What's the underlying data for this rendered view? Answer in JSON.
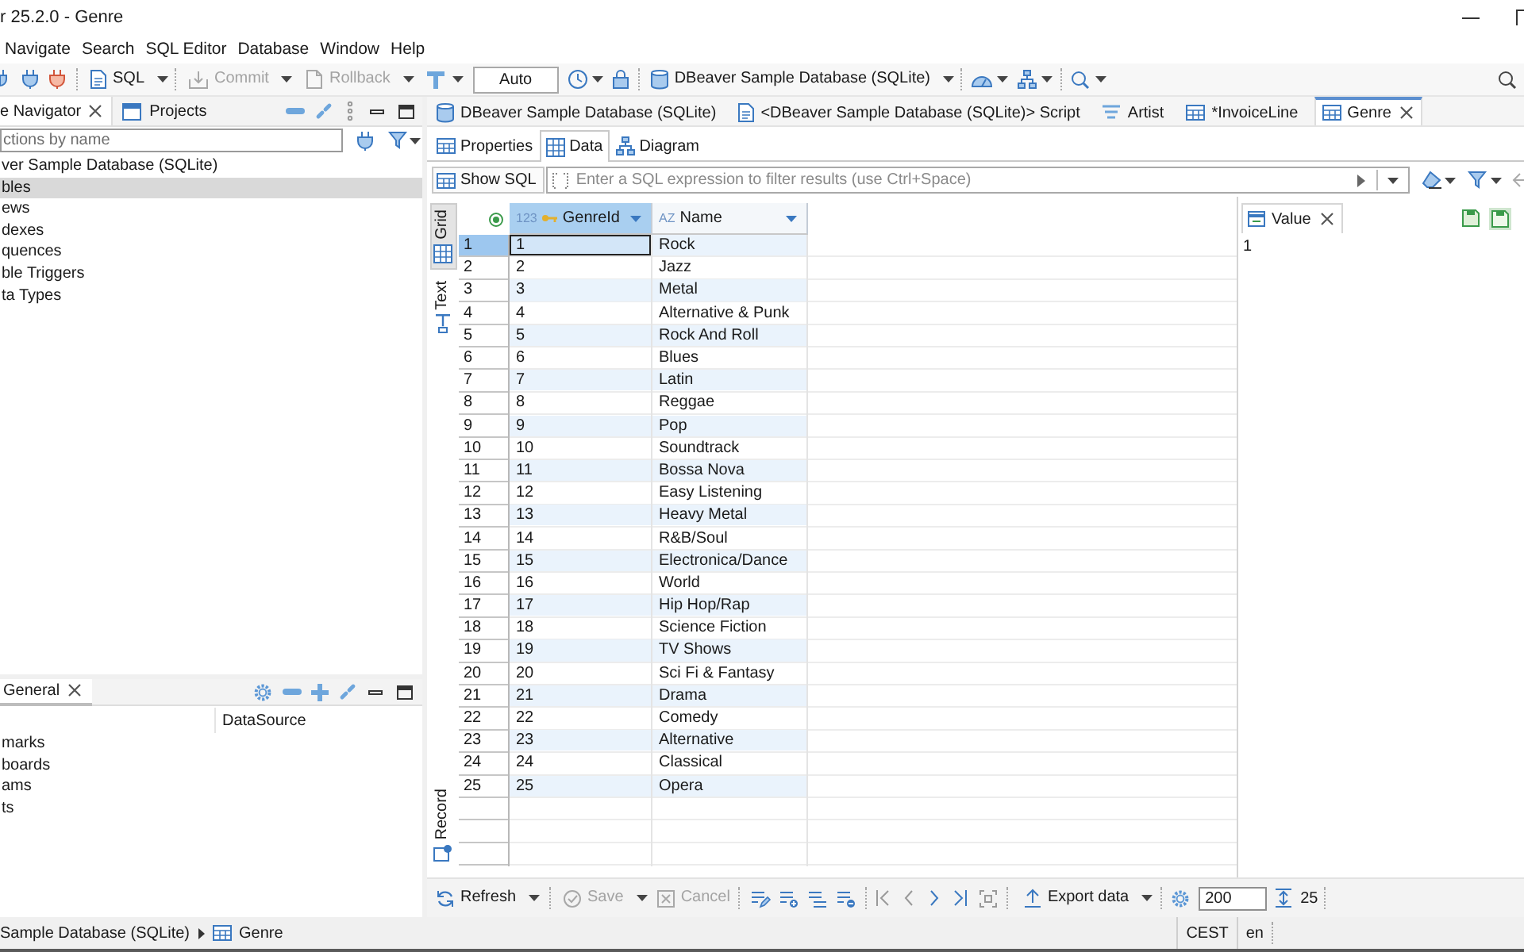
{
  "window": {
    "title": "r 25.2.0 - Genre"
  },
  "menu_bar": {
    "items": [
      "Navigate",
      "Search",
      "SQL Editor",
      "Database",
      "Window",
      "Help"
    ]
  },
  "toolbar": {
    "buttons": [
      {
        "label": "SQL",
        "disabled": false
      },
      {
        "label": "Commit",
        "disabled": true
      },
      {
        "label": "Rollback",
        "disabled": true
      }
    ],
    "transaction_mode": "Auto",
    "active_connection": "DBeaver Sample Database (SQLite)"
  },
  "navigator": {
    "tabs": [
      {
        "label": "e Navigator",
        "selected": true
      },
      {
        "label": "Projects",
        "selected": false
      }
    ],
    "filter": {
      "placeholder": "ctions by name"
    },
    "tree": [
      {
        "label": "ver Sample Database (SQLite)",
        "selected": false,
        "children": [
          {
            "label": "bles",
            "selected": true
          },
          {
            "label": "ews",
            "selected": false
          },
          {
            "label": "dexes",
            "selected": false
          },
          {
            "label": "quences",
            "selected": false
          },
          {
            "label": "ble Triggers",
            "selected": false
          },
          {
            "label": "ta Types",
            "selected": false
          }
        ]
      }
    ]
  },
  "general_panel": {
    "tabs": [
      {
        "label": "General",
        "selected": true
      }
    ],
    "column_2": "DataSource",
    "items": [
      "marks",
      "boards",
      "ams",
      "ts"
    ]
  },
  "editor_tabs": [
    {
      "label": "DBeaver Sample Database (SQLite)",
      "kind": "connection",
      "selected": false
    },
    {
      "label": "<DBeaver Sample Database (SQLite)> Script",
      "kind": "script",
      "selected": false
    },
    {
      "label": "Artist",
      "kind": "view",
      "selected": false
    },
    {
      "label": "*InvoiceLine",
      "kind": "table",
      "selected": false
    },
    {
      "label": "Genre",
      "kind": "table",
      "selected": true
    }
  ],
  "sub_tabs": [
    {
      "label": "Properties",
      "kind": "properties",
      "selected": false
    },
    {
      "label": "Data",
      "kind": "data",
      "selected": true
    },
    {
      "label": "Diagram",
      "kind": "diagram",
      "selected": false
    }
  ],
  "filter_bar": {
    "show_sql": "Show SQL",
    "placeholder": "Enter a SQL expression to filter results (use Ctrl+Space)"
  },
  "view_tabs": [
    {
      "label": "Grid",
      "kind": "grid",
      "selected": true
    },
    {
      "label": "Text",
      "kind": "text",
      "selected": false
    }
  ],
  "record_toggle": {
    "label": "Record",
    "on": false
  },
  "grid": {
    "columns": [
      {
        "label": "GenreId",
        "type_mark": "123",
        "key": true,
        "selected": true
      },
      {
        "label": "Name",
        "type_mark": "AZ",
        "key": false,
        "selected": false
      }
    ],
    "rows": [
      {
        "number": "1",
        "cells": [
          "1",
          "Rock"
        ],
        "selected": true
      },
      {
        "number": "2",
        "cells": [
          "2",
          "Jazz"
        ],
        "selected": false
      },
      {
        "number": "3",
        "cells": [
          "3",
          "Metal"
        ],
        "selected": false
      },
      {
        "number": "4",
        "cells": [
          "4",
          "Alternative & Punk"
        ],
        "selected": false
      },
      {
        "number": "5",
        "cells": [
          "5",
          "Rock And Roll"
        ],
        "selected": false
      },
      {
        "number": "6",
        "cells": [
          "6",
          "Blues"
        ],
        "selected": false
      },
      {
        "number": "7",
        "cells": [
          "7",
          "Latin"
        ],
        "selected": false
      },
      {
        "number": "8",
        "cells": [
          "8",
          "Reggae"
        ],
        "selected": false
      },
      {
        "number": "9",
        "cells": [
          "9",
          "Pop"
        ],
        "selected": false
      },
      {
        "number": "10",
        "cells": [
          "10",
          "Soundtrack"
        ],
        "selected": false
      },
      {
        "number": "11",
        "cells": [
          "11",
          "Bossa Nova"
        ],
        "selected": false
      },
      {
        "number": "12",
        "cells": [
          "12",
          "Easy Listening"
        ],
        "selected": false
      },
      {
        "number": "13",
        "cells": [
          "13",
          "Heavy Metal"
        ],
        "selected": false
      },
      {
        "number": "14",
        "cells": [
          "14",
          "R&B/Soul"
        ],
        "selected": false
      },
      {
        "number": "15",
        "cells": [
          "15",
          "Electronica/Dance"
        ],
        "selected": false
      },
      {
        "number": "16",
        "cells": [
          "16",
          "World"
        ],
        "selected": false
      },
      {
        "number": "17",
        "cells": [
          "17",
          "Hip Hop/Rap"
        ],
        "selected": false
      },
      {
        "number": "18",
        "cells": [
          "18",
          "Science Fiction"
        ],
        "selected": false
      },
      {
        "number": "19",
        "cells": [
          "19",
          "TV Shows"
        ],
        "selected": false
      },
      {
        "number": "20",
        "cells": [
          "20",
          "Sci Fi & Fantasy"
        ],
        "selected": false
      },
      {
        "number": "21",
        "cells": [
          "21",
          "Drama"
        ],
        "selected": false
      },
      {
        "number": "22",
        "cells": [
          "22",
          "Comedy"
        ],
        "selected": false
      },
      {
        "number": "23",
        "cells": [
          "23",
          "Alternative"
        ],
        "selected": false
      },
      {
        "number": "24",
        "cells": [
          "24",
          "Classical"
        ],
        "selected": false
      },
      {
        "number": "25",
        "cells": [
          "25",
          "Opera"
        ],
        "selected": false
      }
    ]
  },
  "value_panel": {
    "tab": "Value",
    "value": "1"
  },
  "results_toolbar": {
    "buttons": [
      {
        "label": "Refresh",
        "disabled": false
      },
      {
        "label": "Save",
        "disabled": true
      },
      {
        "label": "Cancel",
        "disabled": true
      },
      {
        "label": "Export data",
        "disabled": false
      }
    ],
    "fetch_size": "200",
    "row_count": "25"
  },
  "status_bar": {
    "breadcrumb": [
      "Sample Database (SQLite)",
      "Genre"
    ],
    "timezone": "CEST",
    "locale": "en"
  }
}
